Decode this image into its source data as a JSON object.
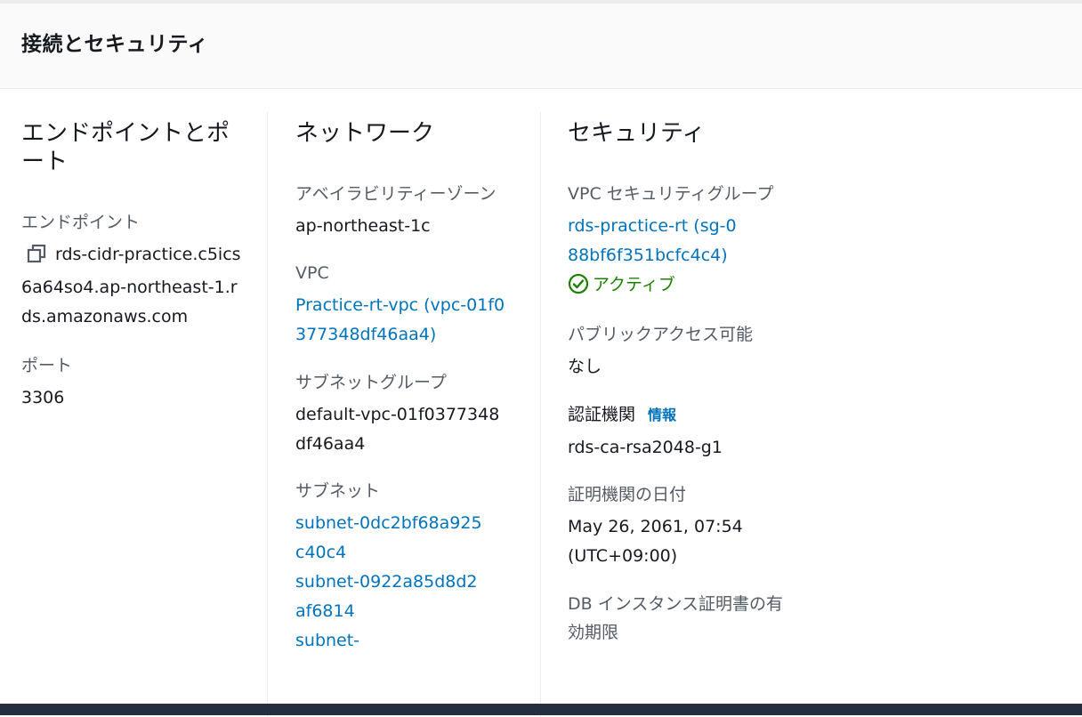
{
  "section": {
    "title": "接続とセキュリティ"
  },
  "endpoint_col": {
    "title": "エンドポイントとポート",
    "endpoint_label": "エンドポイント",
    "endpoint_value": "rds-cidr-practice.c5ics6a64so4.ap-northeast-1.rds.amazonaws.com",
    "port_label": "ポート",
    "port_value": "3306"
  },
  "network_col": {
    "title": "ネットワーク",
    "az_label": "アベイラビリティーゾーン",
    "az_value": "ap-northeast-1c",
    "vpc_label": "VPC",
    "vpc_value": "Practice-rt-vpc (vpc-01f0377348df46aa4)",
    "subnet_group_label": "サブネットグループ",
    "subnet_group_value": "default-vpc-01f0377348df46aa4",
    "subnets_label": "サブネット",
    "subnets": [
      "subnet-0dc2bf68a925c40c4",
      "subnet-0922a85d8d2af6814",
      "subnet-"
    ]
  },
  "security_col": {
    "title": "セキュリティ",
    "sg_label": "VPC セキュリティグループ",
    "sg_value": "rds-practice-rt (sg-088bf6f351bcfc4c4)",
    "sg_status": "アクティブ",
    "public_label": "パブリックアクセス可能",
    "public_value": "なし",
    "ca_label": "認証機関",
    "ca_info": "情報",
    "ca_value": "rds-ca-rsa2048-g1",
    "ca_date_label": "証明機関の日付",
    "ca_date_value": "May 26, 2061, 07:54 (UTC+09:00)",
    "db_cert_label": "DB インスタンス証明書の有効期限"
  },
  "colors": {
    "link": "#0073bb",
    "success": "#1d8102",
    "footer": "#232f3e"
  },
  "icons": {
    "copy": "copy-icon",
    "status": "check-circle-icon"
  }
}
